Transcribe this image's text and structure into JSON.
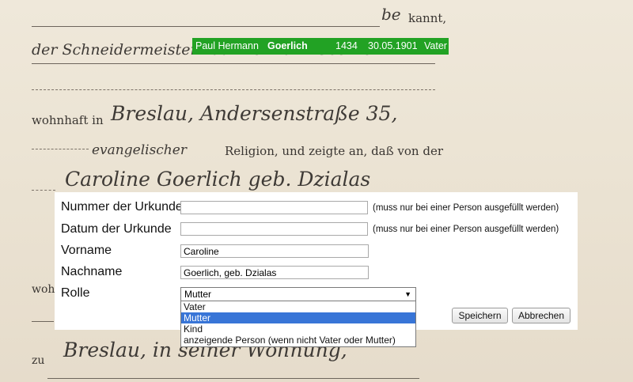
{
  "document": {
    "line1_script": "be",
    "line1_print": "kannt,",
    "line2_script": "der Schneidermeister Paul Hermann Goerlich",
    "line3_print": "wohnhaft in",
    "line3_script": "Breslau, Andersenstraße 35,",
    "line4_script": "evangelischer",
    "line4_print": "Religion, und zeigte an, daß von der",
    "line5_script": "Caroline Goerlich geb. Dzialas",
    "side_print_1": "woh",
    "bottom_print": "zu",
    "bottom_script": "Breslau, in seiner Wohnung,"
  },
  "person": {
    "given_names": "Paul Hermann",
    "surname": "Goerlich",
    "number": "1434",
    "date": "30.05.1901",
    "role": "Vater"
  },
  "form": {
    "certificate_number": {
      "label": "Nummer der Urkunde",
      "value": "",
      "hint": "(muss nur bei einer Person ausgefüllt werden)"
    },
    "certificate_date": {
      "label": "Datum der Urkunde",
      "value": "",
      "hint": "(muss nur bei einer Person ausgefüllt werden)"
    },
    "first_name": {
      "label": "Vorname",
      "value": "Caroline"
    },
    "last_name": {
      "label": "Nachname",
      "value": "Goerlich, geb. Dzialas"
    },
    "role": {
      "label": "Rolle",
      "selected": "Mutter",
      "options": [
        "Vater",
        "Mutter",
        "Kind",
        "anzeigende Person (wenn nicht Vater oder Mutter)"
      ]
    },
    "save_label": "Speichern",
    "cancel_label": "Abbrechen"
  },
  "colors": {
    "person_bar": "#22a224",
    "selection": "#3875d7",
    "paper": "#ebe3d3"
  }
}
